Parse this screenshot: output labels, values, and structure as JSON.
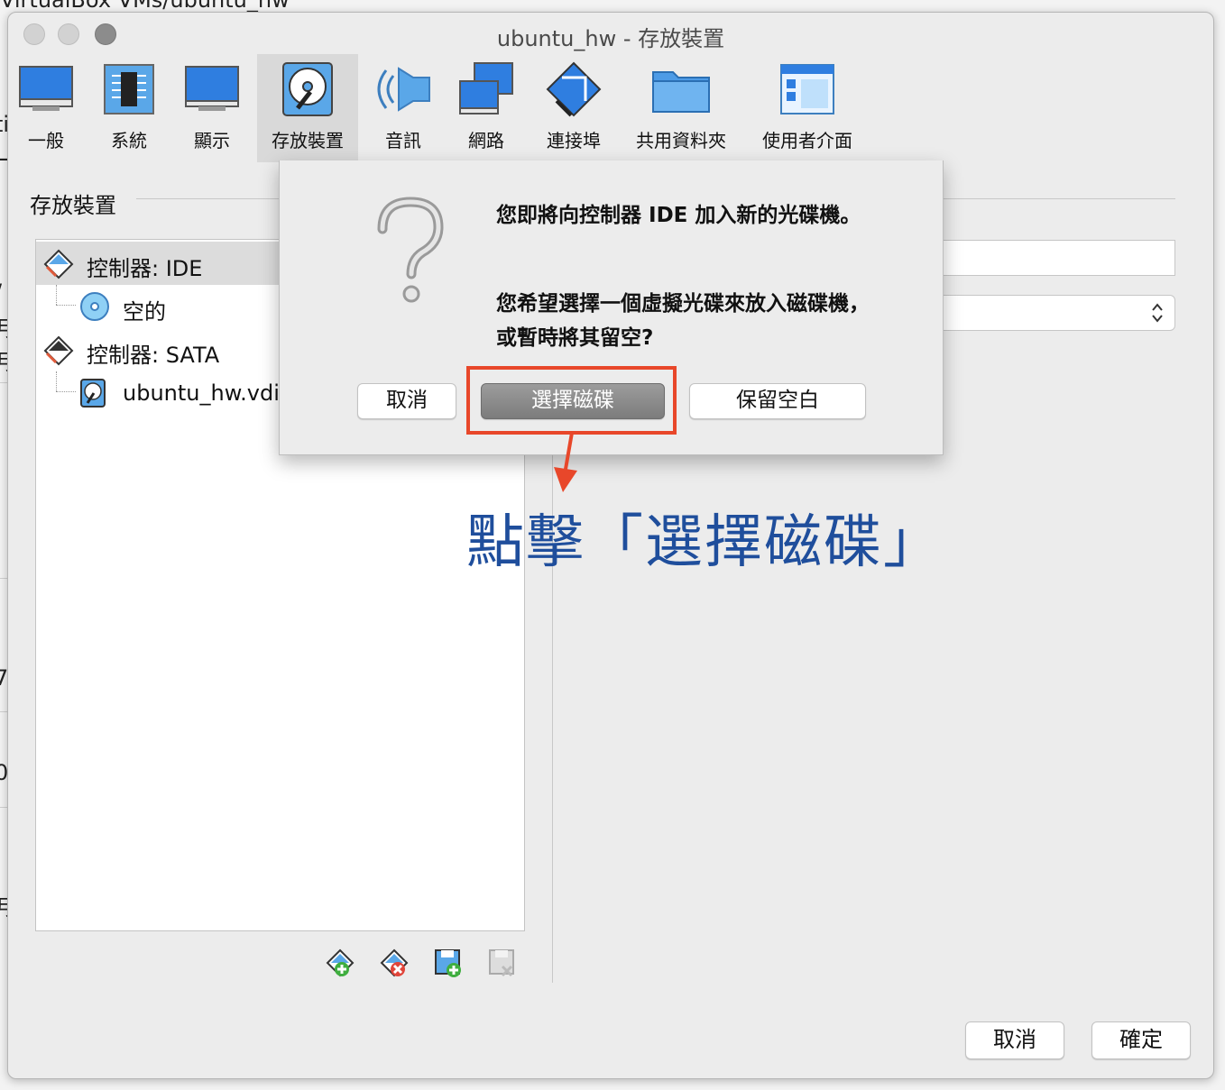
{
  "background": {
    "path_text": "VirtualBox VMs/ubuntu_hw",
    "left_chars": [
      "ting",
      "ー",
      "/",
      "月",
      "月",
      "i",
      "7",
      "0",
      "月"
    ]
  },
  "window": {
    "title": "ubuntu_hw - 存放裝置"
  },
  "toolbar": {
    "items": [
      {
        "label": "一般",
        "icon": "monitor-general-icon"
      },
      {
        "label": "系統",
        "icon": "chip-system-icon"
      },
      {
        "label": "顯示",
        "icon": "display-monitor-icon"
      },
      {
        "label": "存放裝置",
        "icon": "storage-disk-icon",
        "selected": true
      },
      {
        "label": "音訊",
        "icon": "speaker-audio-icon"
      },
      {
        "label": "網路",
        "icon": "network-monitors-icon"
      },
      {
        "label": "連接埠",
        "icon": "serial-port-icon"
      },
      {
        "label": "共用資料夾",
        "icon": "shared-folder-icon"
      },
      {
        "label": "使用者介面",
        "icon": "user-interface-icon"
      }
    ]
  },
  "storage": {
    "section_title": "存放裝置",
    "tree": {
      "ide_controller": "控制器: IDE",
      "ide_empty": "空的",
      "sata_controller": "控制器: SATA",
      "sata_disk": "ubuntu_hw.vdi"
    }
  },
  "footer": {
    "cancel": "取消",
    "ok": "確定"
  },
  "dialog": {
    "message1": "您即將向控制器 IDE 加入新的光碟機。",
    "message2": "您希望選擇一個虛擬光碟來放入磁碟機，或暫時將其留空?",
    "cancel": "取消",
    "choose_disk": "選擇磁碟",
    "leave_empty": "保留空白"
  },
  "annotation": {
    "text": "點擊「選擇磁碟」",
    "color": "#1f4e9c",
    "highlight_color": "#e8472a"
  }
}
